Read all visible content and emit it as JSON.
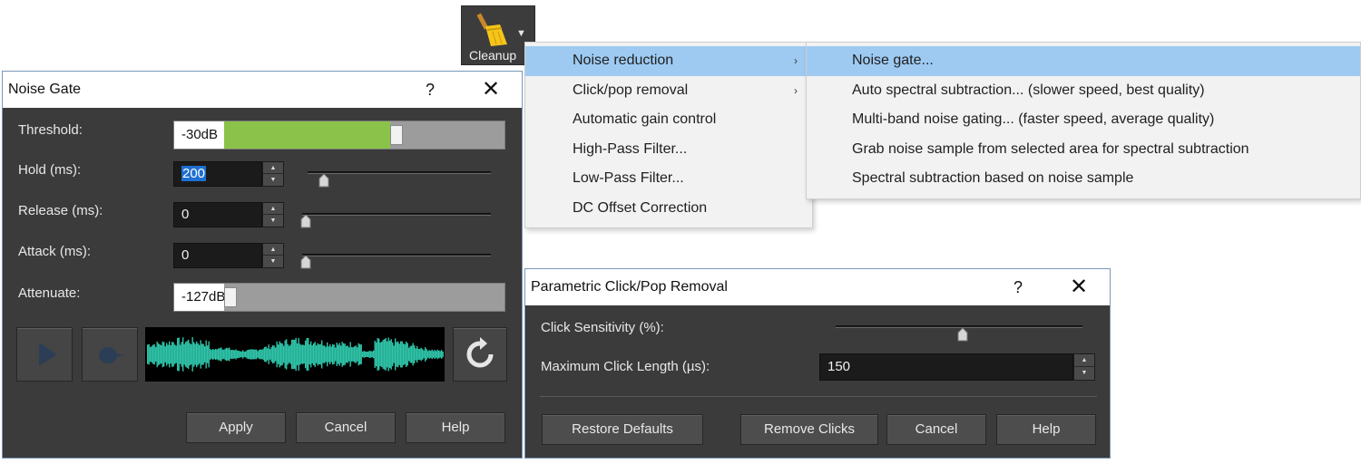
{
  "toolbar": {
    "cleanup_label": "Cleanup",
    "cleanup_icon": "broom-icon"
  },
  "cleanup_menu": {
    "items": [
      {
        "label": "Noise reduction",
        "has_submenu": true,
        "highlighted": true
      },
      {
        "label": "Click/pop removal",
        "has_submenu": true
      },
      {
        "label": "Automatic gain control"
      },
      {
        "label": "High-Pass Filter..."
      },
      {
        "label": "Low-Pass Filter..."
      },
      {
        "label": "DC Offset Correction"
      }
    ],
    "submenu_arrow": "›"
  },
  "noise_reduction_submenu": {
    "items": [
      {
        "label": "Noise gate...",
        "highlighted": true
      },
      {
        "label": "Auto spectral subtraction... (slower speed, best quality)"
      },
      {
        "label": "Multi-band noise gating... (faster speed, average quality)"
      },
      {
        "label": "Grab noise sample from selected area for spectral subtraction"
      },
      {
        "label": "Spectral subtraction based on noise sample"
      }
    ]
  },
  "noise_gate": {
    "title": "Noise Gate",
    "help_glyph": "?",
    "close_glyph": "✕",
    "threshold": {
      "label": "Threshold:",
      "value": "-30dB",
      "level": 0.62
    },
    "hold": {
      "label": "Hold (ms):",
      "value": "200",
      "slider": 0.07
    },
    "release": {
      "label": "Release (ms):",
      "value": "0",
      "slider": 0.0
    },
    "attack": {
      "label": "Attack (ms):",
      "value": "0",
      "slider": 0.0
    },
    "attenuate": {
      "label": "Attenuate:",
      "value": "-127dB",
      "level": 0.0
    },
    "buttons": {
      "apply": "Apply",
      "cancel": "Cancel",
      "help": "Help"
    },
    "icons": {
      "play": "play-icon",
      "record": "record-icon",
      "reset": "refresh-icon"
    },
    "waveform_color": "#2ec4a8"
  },
  "click_pop": {
    "title": "Parametric Click/Pop Removal",
    "help_glyph": "?",
    "close_glyph": "✕",
    "sensitivity": {
      "label": "Click Sensitivity (%):",
      "slider": 0.5
    },
    "max_length": {
      "label": "Maximum Click Length (µs):",
      "value": "150"
    },
    "buttons": {
      "restore": "Restore Defaults",
      "remove": "Remove Clicks",
      "cancel": "Cancel",
      "help": "Help"
    }
  },
  "colors": {
    "dialog_bg": "#3b3b3b",
    "menu_highlight": "#9ecaf2",
    "meter_fill": "#8bc34a"
  }
}
